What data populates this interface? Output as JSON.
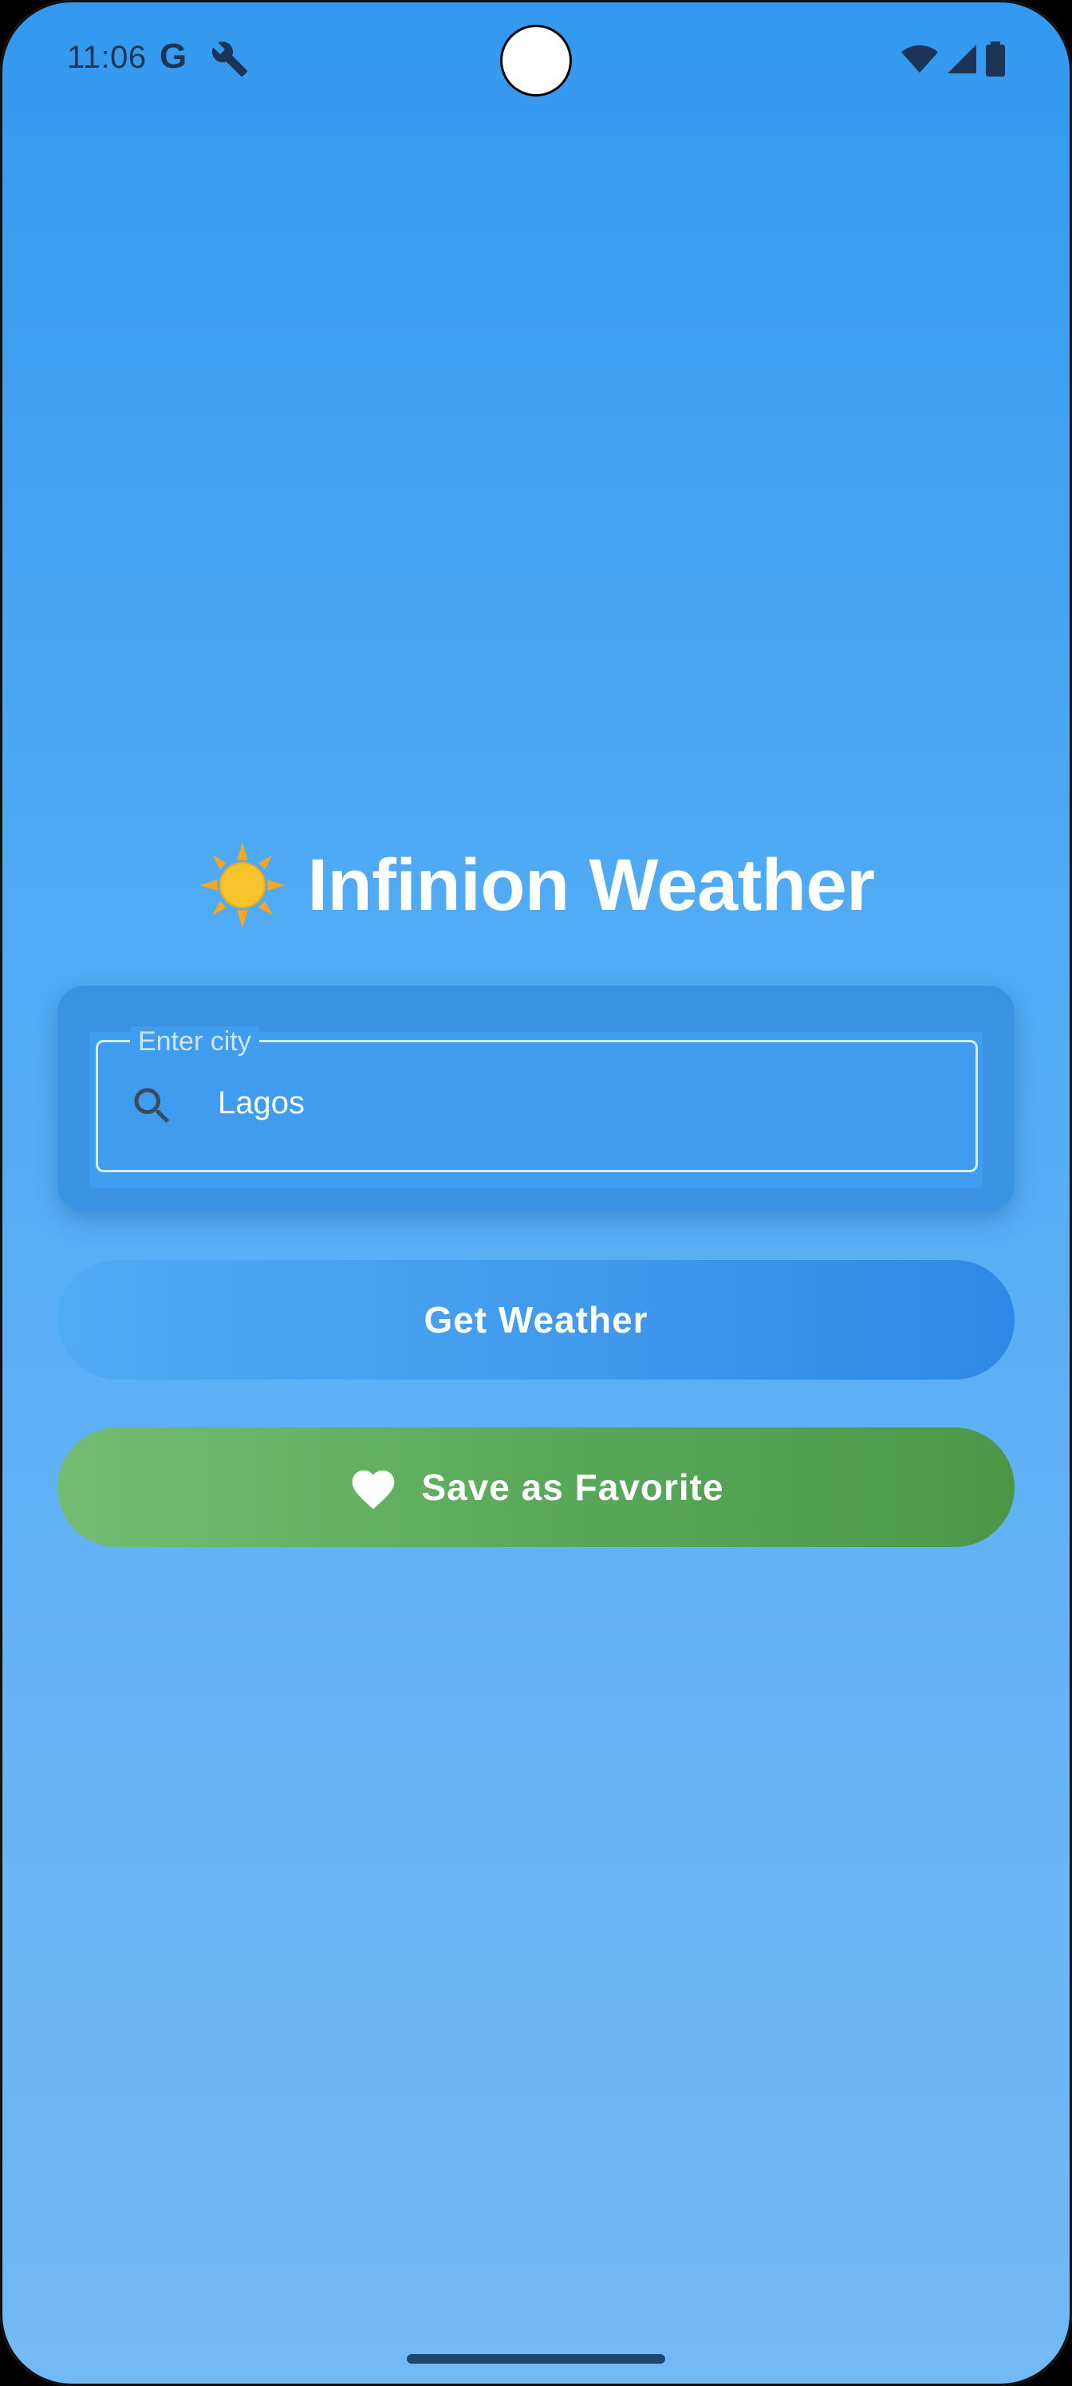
{
  "status_bar": {
    "time": "11:06",
    "google_icon_text": "G",
    "icons": [
      "google-icon",
      "wrench-icon",
      "wifi-icon",
      "signal-icon",
      "battery-icon"
    ]
  },
  "app": {
    "title": "Infinion Weather",
    "title_icon": "sun-icon"
  },
  "search": {
    "label": "Enter city",
    "value": "Lagos",
    "icon": "search-icon"
  },
  "buttons": {
    "get_weather": "Get Weather",
    "save_favorite": "Save as Favorite",
    "save_favorite_icon": "heart-icon"
  },
  "colors": {
    "background_top": "#3399f0",
    "background_bottom": "#73b9f5",
    "favorite_button": "#5aa95a",
    "weather_button": "#3f98ec"
  }
}
